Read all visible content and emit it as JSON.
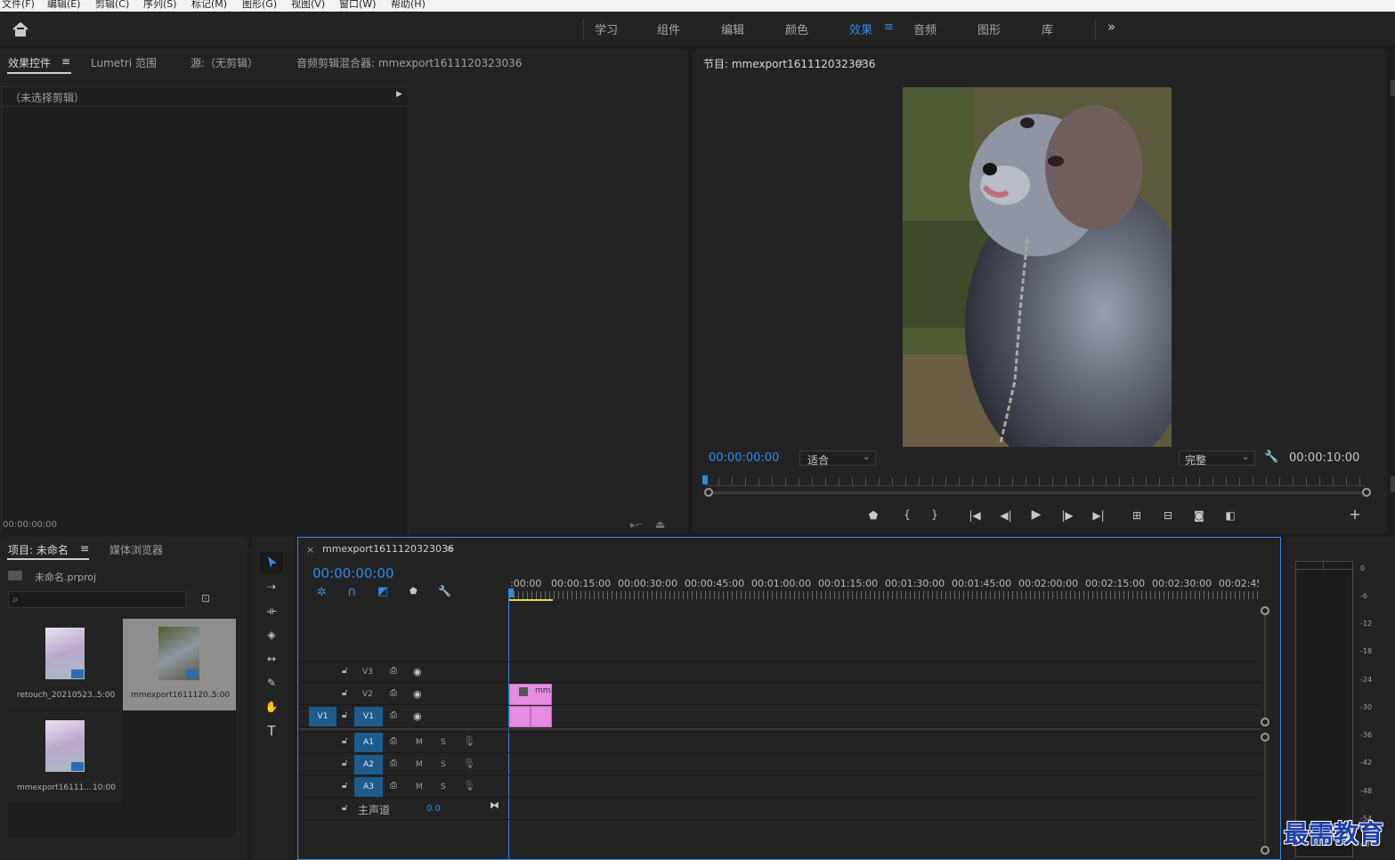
{
  "menubar": [
    "文件(F)",
    "编辑(E)",
    "剪辑(C)",
    "序列(S)",
    "标记(M)",
    "图形(G)",
    "视图(V)",
    "窗口(W)",
    "帮助(H)"
  ],
  "workspaces": [
    "学习",
    "组件",
    "编辑",
    "颜色",
    "效果",
    "音频",
    "图形",
    "库"
  ],
  "workspace_active": "效果",
  "left_panel": {
    "tabs": [
      "效果控件",
      "Lumetri 范围",
      "源:（无剪辑）",
      "音频剪辑混合器: mmexport1611120323036"
    ],
    "no_clip": "（未选择剪辑）",
    "timecode": "00:00:00:00"
  },
  "program": {
    "title": "节目: mmexport1611120323036",
    "timecode": "00:00:00:00",
    "fit": "适合",
    "quality": "完整",
    "duration": "00:00:10:00"
  },
  "project": {
    "tabs": [
      "项目: 未命名",
      "媒体浏览器"
    ],
    "file": "未命名.prproj",
    "search_placeholder": "",
    "items": [
      {
        "name": "retouch_20210523...",
        "dur": "5:00"
      },
      {
        "name": "mmexport1611120...",
        "dur": "5:00"
      },
      {
        "name": "mmexport16111...",
        "dur": "10:00"
      }
    ]
  },
  "timeline": {
    "close": "×",
    "title": "mmexport1611120323036",
    "timecode": "00:00:00:00",
    "ruler": [
      ":00:00",
      "00:00:15:00",
      "00:00:30:00",
      "00:00:45:00",
      "00:01:00:00",
      "00:01:15:00",
      "00:01:30:00",
      "00:01:45:00",
      "00:02:00:00",
      "00:02:15:00",
      "00:02:30:00",
      "00:02:45:0"
    ],
    "video_tracks": [
      "V3",
      "V2",
      "V1"
    ],
    "source_patch": "V1",
    "audio_tracks": [
      "A1",
      "A2",
      "A3"
    ],
    "master_label": "主声道",
    "master_value": "0.0",
    "mute": "M",
    "solo": "S",
    "clip_label": "mm"
  },
  "meter": {
    "labels": [
      "0",
      "-6",
      "-12",
      "-18",
      "-24",
      "-30",
      "-36",
      "-42",
      "-48",
      "-54",
      "dB"
    ]
  },
  "watermark": "最需教育",
  "colors": {
    "accent": "#2d8ceb",
    "clip": "#e58de0",
    "track_target": "#1e5c8e"
  }
}
